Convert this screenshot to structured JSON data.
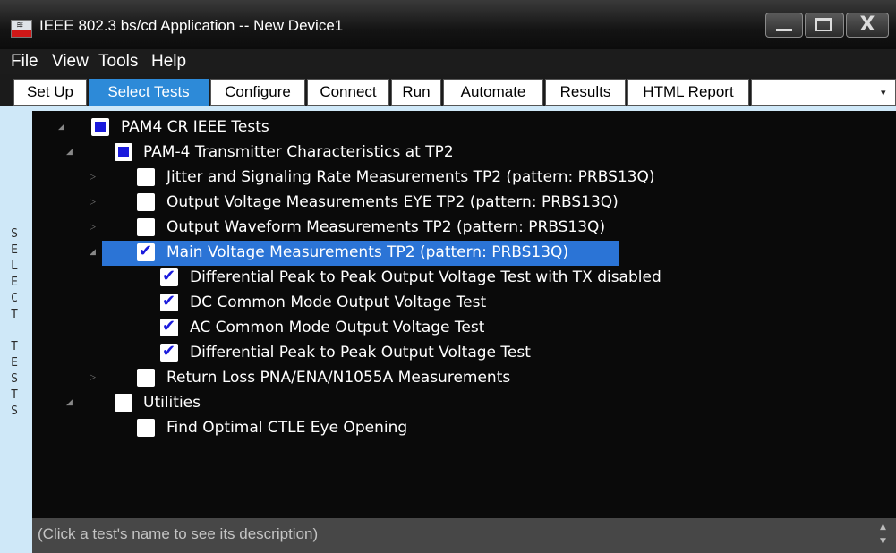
{
  "window": {
    "title": "IEEE 802.3 bs/cd Application -- New Device1",
    "icon_glyph": "≋",
    "close_glyph": "X"
  },
  "menu": [
    "File",
    "View",
    "Tools",
    "Help"
  ],
  "tabs": [
    "Set Up",
    "Select Tests",
    "Configure",
    "Connect",
    "Run",
    "Automate",
    "Results",
    "HTML Report"
  ],
  "active_tab": "Select Tests",
  "tab_overflow_glyph": "▾",
  "side_label": [
    "S",
    "E",
    "L",
    "E",
    "C",
    "T",
    "",
    "T",
    "E",
    "S",
    "T",
    "S"
  ],
  "tree": [
    {
      "label": "PAM4 CR IEEE Tests",
      "state": "partial",
      "expander": "◢",
      "level": 0
    },
    {
      "label": "PAM-4 Transmitter Characteristics at TP2",
      "state": "partial",
      "expander": "◢",
      "level": 1
    },
    {
      "label": "Jitter and Signaling Rate Measurements TP2 (pattern: PRBS13Q)",
      "state": "unchecked",
      "expander": "▷",
      "level": 2
    },
    {
      "label": "Output Voltage Measurements EYE TP2 (pattern: PRBS13Q)",
      "state": "unchecked",
      "expander": "▷",
      "level": 2
    },
    {
      "label": "Output Waveform Measurements TP2 (pattern: PRBS13Q)",
      "state": "unchecked",
      "expander": "▷",
      "level": 2
    },
    {
      "label": "Main Voltage Measurements TP2 (pattern: PRBS13Q)",
      "state": "checked",
      "expander": "◢",
      "level": 2,
      "selected": true
    },
    {
      "label": "Differential Peak to Peak Output Voltage Test with TX disabled",
      "state": "checked",
      "expander": "",
      "level": 3
    },
    {
      "label": "DC Common Mode Output Voltage Test",
      "state": "checked",
      "expander": "",
      "level": 3
    },
    {
      "label": "AC Common Mode Output Voltage Test",
      "state": "checked",
      "expander": "",
      "level": 3
    },
    {
      "label": "Differential Peak to Peak Output Voltage Test",
      "state": "checked",
      "expander": "",
      "level": 3
    },
    {
      "label": "Return Loss PNA/ENA/N1055A Measurements",
      "state": "unchecked",
      "expander": "▷",
      "level": 2
    },
    {
      "label": "Utilities",
      "state": "unchecked",
      "expander": "◢",
      "level": 1
    },
    {
      "label": "Find Optimal CTLE Eye Opening",
      "state": "unchecked",
      "expander": "",
      "level": 2
    }
  ],
  "description": "(Click a test's name to see its description)",
  "scroll_up_glyph": "▲",
  "scroll_down_glyph": "▼",
  "colors": {
    "selection": "#2b74d6",
    "active_tab": "#2d8ad8",
    "checkbox_mark": "#1a1adc",
    "frame": "#cfe8f8"
  }
}
